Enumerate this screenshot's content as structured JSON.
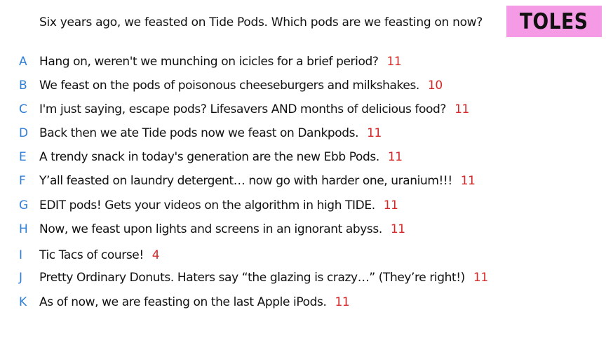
{
  "question": "Six years ago, we feasted on Tide Pods. Which pods are we feasting on now?",
  "badge": "TOLES",
  "colors": {
    "badge_bg": "#f59be6",
    "letter": "#2f7fd8",
    "score": "#d62828"
  },
  "answers": [
    {
      "letter": "A",
      "text": "Hang on, weren't we munching on icicles for a brief period?",
      "score": "11"
    },
    {
      "letter": "B",
      "text": "We feast on the pods of poisonous cheeseburgers and milkshakes.",
      "score": "10"
    },
    {
      "letter": "C",
      "text": "I'm just saying, escape pods? Lifesavers AND months of delicious food?",
      "score": "11"
    },
    {
      "letter": "D",
      "text": "Back then we ate Tide pods now we feast on Dankpods.",
      "score": "11"
    },
    {
      "letter": "E",
      "text": "A trendy snack in today's generation are the new Ebb Pods.",
      "score": "11"
    },
    {
      "letter": "F",
      "text": "Y’all feasted on laundry detergent… now go with harder one, uranium!!!",
      "score": "11"
    },
    {
      "letter": "G",
      "text": "EDIT pods! Gets your videos on the algorithm in high TIDE.",
      "score": "11"
    },
    {
      "letter": "H",
      "text": "Now, we feast upon lights and screens in an ignorant abyss.",
      "score": "11"
    },
    {
      "letter": "I",
      "text": "Tic Tacs of course!",
      "score": "4"
    },
    {
      "letter": "J",
      "text": "Pretty Ordinary Donuts. Haters say “the glazing is crazy…” (They’re right!)",
      "score": "11"
    },
    {
      "letter": "K",
      "text": "As of now, we are feasting on the last Apple iPods.",
      "score": "11"
    }
  ]
}
